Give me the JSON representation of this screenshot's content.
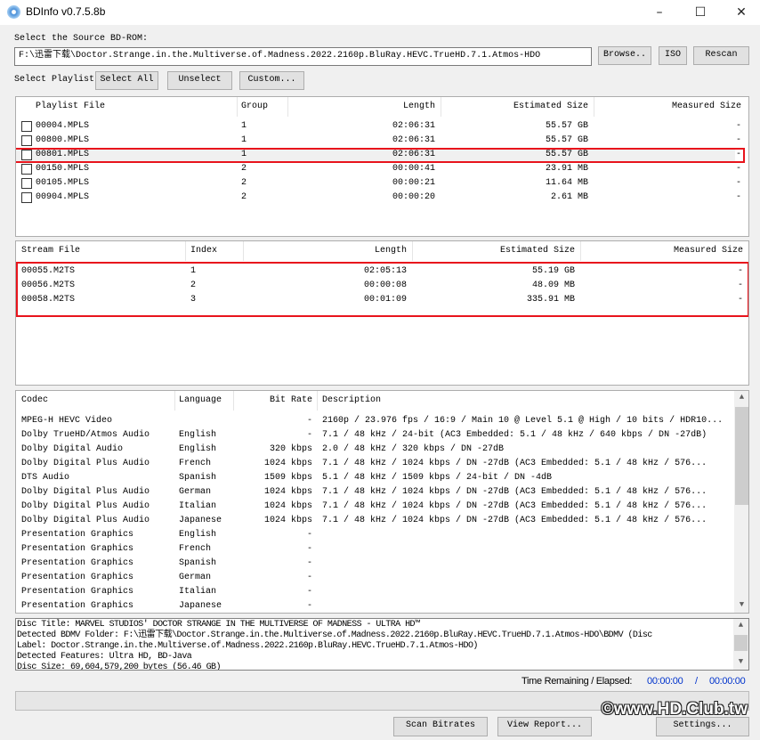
{
  "window": {
    "title": "BDInfo v0.7.5.8b",
    "minimize": "–",
    "maximize": "☐",
    "close": "✕"
  },
  "source": {
    "label": "Select the Source BD-ROM:",
    "path": "F:\\迅雷下载\\Doctor.Strange.in.the.Multiverse.of.Madness.2022.2160p.BluRay.HEVC.TrueHD.7.1.Atmos-HDO",
    "browse": "Browse..",
    "iso": "ISO",
    "rescan": "Rescan"
  },
  "playlist_select": {
    "label": "Select Playlist",
    "select_all": "Select All",
    "unselect": "Unselect",
    "custom": "Custom..."
  },
  "playlists": {
    "headers": [
      "Playlist File",
      "Group",
      "Length",
      "Estimated Size",
      "Measured Size"
    ],
    "rows": [
      [
        "00004.MPLS",
        "1",
        "02:06:31",
        "55.57 GB",
        "-"
      ],
      [
        "00800.MPLS",
        "1",
        "02:06:31",
        "55.57 GB",
        "-"
      ],
      [
        "00801.MPLS",
        "1",
        "02:06:31",
        "55.57 GB",
        "-"
      ],
      [
        "00150.MPLS",
        "2",
        "00:00:41",
        "23.91 MB",
        "-"
      ],
      [
        "00105.MPLS",
        "2",
        "00:00:21",
        "11.64 MB",
        "-"
      ],
      [
        "00904.MPLS",
        "2",
        "00:00:20",
        "2.61 MB",
        "-"
      ]
    ],
    "highlighted": 2
  },
  "streams": {
    "headers": [
      "Stream File",
      "Index",
      "Length",
      "Estimated Size",
      "Measured Size"
    ],
    "rows": [
      [
        "00055.M2TS",
        "1",
        "02:05:13",
        "55.19 GB",
        "-"
      ],
      [
        "00056.M2TS",
        "2",
        "00:00:08",
        "48.09 MB",
        "-"
      ],
      [
        "00058.M2TS",
        "3",
        "00:01:09",
        "335.91 MB",
        "-"
      ]
    ]
  },
  "codecs": {
    "headers": [
      "Codec",
      "Language",
      "Bit Rate",
      "Description"
    ],
    "rows": [
      [
        "MPEG-H HEVC Video",
        "",
        "-",
        "2160p / 23.976 fps / 16:9 / Main 10 @ Level 5.1 @ High / 10 bits / HDR10..."
      ],
      [
        "Dolby TrueHD/Atmos Audio",
        "English",
        "-",
        "7.1 / 48 kHz / 24-bit (AC3 Embedded: 5.1 / 48 kHz /   640 kbps / DN -27dB)"
      ],
      [
        "Dolby Digital Audio",
        "English",
        "320 kbps",
        "2.0 / 48 kHz /   320 kbps / DN -27dB"
      ],
      [
        "Dolby Digital Plus Audio",
        "French",
        "1024 kbps",
        "7.1 / 48 kHz /  1024 kbps / DN -27dB (AC3 Embedded: 5.1 / 48 kHz /   576..."
      ],
      [
        "DTS Audio",
        "Spanish",
        "1509 kbps",
        "5.1 / 48 kHz /  1509 kbps / 24-bit / DN -4dB"
      ],
      [
        "Dolby Digital Plus Audio",
        "German",
        "1024 kbps",
        "7.1 / 48 kHz /  1024 kbps / DN -27dB (AC3 Embedded: 5.1 / 48 kHz /   576..."
      ],
      [
        "Dolby Digital Plus Audio",
        "Italian",
        "1024 kbps",
        "7.1 / 48 kHz /  1024 kbps / DN -27dB (AC3 Embedded: 5.1 / 48 kHz /   576..."
      ],
      [
        "Dolby Digital Plus Audio",
        "Japanese",
        "1024 kbps",
        "7.1 / 48 kHz /  1024 kbps / DN -27dB (AC3 Embedded: 5.1 / 48 kHz /   576..."
      ],
      [
        "Presentation Graphics",
        "English",
        "-",
        ""
      ],
      [
        "Presentation Graphics",
        "French",
        "-",
        ""
      ],
      [
        "Presentation Graphics",
        "Spanish",
        "-",
        ""
      ],
      [
        "Presentation Graphics",
        "German",
        "-",
        ""
      ],
      [
        "Presentation Graphics",
        "Italian",
        "-",
        ""
      ],
      [
        "Presentation Graphics",
        "Japanese",
        "-",
        ""
      ]
    ]
  },
  "report": {
    "lines": [
      "Disc Title: MARVEL STUDIOS' DOCTOR STRANGE IN THE MULTIVERSE OF MADNESS - ULTRA HD™",
      "Detected BDMV Folder: F:\\迅雷下载\\Doctor.Strange.in.the.Multiverse.of.Madness.2022.2160p.BluRay.HEVC.TrueHD.7.1.Atmos-HDO\\BDMV (Disc",
      "Label: Doctor.Strange.in.the.Multiverse.of.Madness.2022.2160p.BluRay.HEVC.TrueHD.7.1.Atmos-HDO)",
      "Detected Features: Ultra HD, BD-Java",
      "Disc Size: 69,604,579,200 bytes (56.46 GB)"
    ]
  },
  "status": {
    "time_label": "Time Remaining / Elapsed:",
    "remaining": "00:00:00",
    "slash": "/",
    "elapsed": "00:00:00",
    "time_color": "#0033cc",
    "progress": 0
  },
  "buttons": {
    "scan": "Scan Bitrates",
    "report": "View Report...",
    "settings": "Settings..."
  },
  "watermark": "©www.HD.Club.tw"
}
